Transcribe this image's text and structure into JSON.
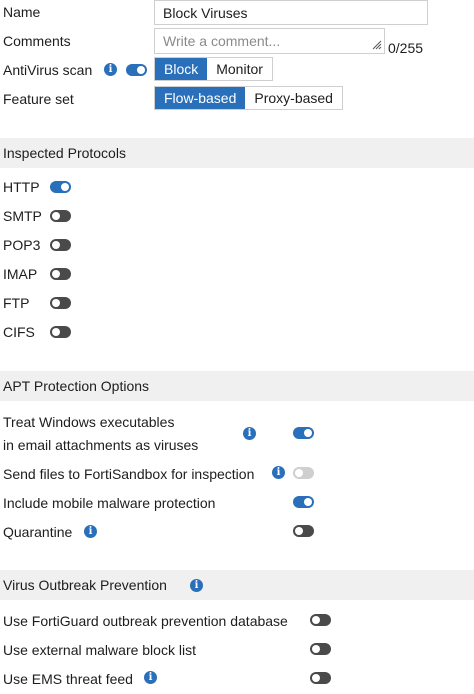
{
  "general": {
    "name_label": "Name",
    "name_value": "Block Viruses",
    "comments_label": "Comments",
    "comments_placeholder": "Write a comment...",
    "comments_counter": "0/255",
    "antivirus_label": "AntiVirus scan",
    "antivirus_enabled": true,
    "antivirus_modes": [
      "Block",
      "Monitor"
    ],
    "antivirus_selected": "Block",
    "feature_set_label": "Feature set",
    "feature_set_options": [
      "Flow-based",
      "Proxy-based"
    ],
    "feature_set_selected": "Flow-based"
  },
  "inspected_protocols": {
    "title": "Inspected Protocols",
    "items": [
      {
        "label": "HTTP",
        "enabled": true
      },
      {
        "label": "SMTP",
        "enabled": false
      },
      {
        "label": "POP3",
        "enabled": false
      },
      {
        "label": "IMAP",
        "enabled": false
      },
      {
        "label": "FTP",
        "enabled": false
      },
      {
        "label": "CIFS",
        "enabled": false
      }
    ]
  },
  "apt_protection": {
    "title": "APT Protection Options",
    "items": [
      {
        "label_line1": "Treat Windows executables",
        "label_line2": "in email attachments as viruses",
        "info_icon": true,
        "state": "on"
      },
      {
        "label": "Send files to FortiSandbox for inspection",
        "info_icon": true,
        "state": "disabled"
      },
      {
        "label": "Include mobile malware protection",
        "info_icon": false,
        "state": "on"
      },
      {
        "label": "Quarantine",
        "info_icon": true,
        "state": "off"
      }
    ]
  },
  "outbreak_prevention": {
    "title": "Virus Outbreak Prevention",
    "items": [
      {
        "label": "Use FortiGuard outbreak prevention database",
        "info_icon": false,
        "state": "off"
      },
      {
        "label": "Use external malware block list",
        "info_icon": false,
        "state": "off"
      },
      {
        "label": "Use EMS threat feed",
        "info_icon": true,
        "state": "off"
      }
    ]
  },
  "colors": {
    "accent": "#2a6fba",
    "toggle_off": "#4a4a4a",
    "toggle_disabled": "#cfcfcf",
    "section_bg": "#f0f0f0"
  },
  "icons": {
    "info": "info-icon",
    "toggle": "toggle-switch"
  }
}
